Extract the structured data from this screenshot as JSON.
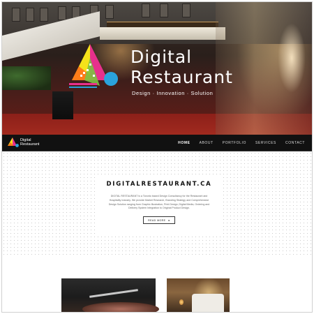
{
  "hero": {
    "title_line1": "Digital",
    "title_line2": "Restaurant",
    "tagline": "Design · Innovation · Solution",
    "logo_colors": [
      "#f5e21a",
      "#e8308c",
      "#2aa3dc",
      "#7cc242",
      "#ff6a1a"
    ]
  },
  "navbar": {
    "brand_line1": "Digital",
    "brand_line2": "Restaurant",
    "menu": [
      {
        "label": "HOME",
        "active": true
      },
      {
        "label": "ABOUT",
        "active": false
      },
      {
        "label": "PORTFOLIO",
        "active": false
      },
      {
        "label": "SERVICES",
        "active": false
      },
      {
        "label": "CONTACT",
        "active": false
      }
    ]
  },
  "card": {
    "title": "DIGITALRESTAURANT.CA",
    "description": "DIGITAL RESTAURANT is a Toronto based Design Consultancy for the Restaurant and Hospitality Industry. We provide Market Research, Branding Strategy and Comprehensive Design Solution ranging from Graphic Illustration, Print Design, Digital Media, Ordering and Delivery System Integration to Original Product Design.",
    "button_label": "READ MORE",
    "button_arrow": "▸"
  }
}
